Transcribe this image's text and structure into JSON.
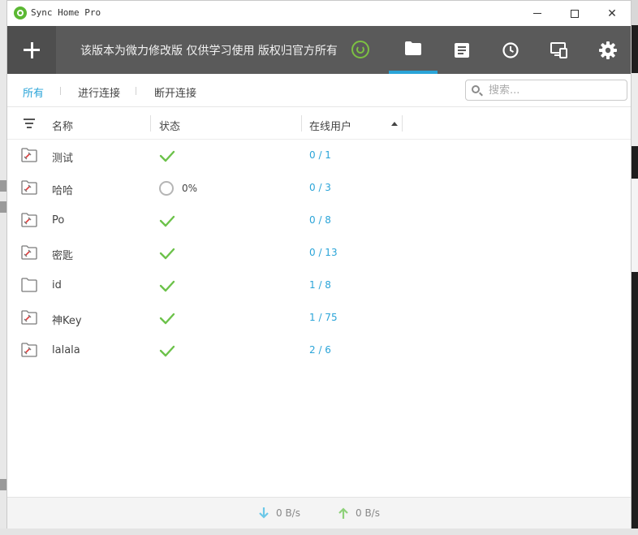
{
  "window": {
    "title": "Sync Home Pro",
    "controls": {
      "minimize": "minimize",
      "maximize": "maximize",
      "close": "✕"
    }
  },
  "toolbar": {
    "banner": "该版本为微力修改版 仅供学习使用 版权归官方所有",
    "tabs": [
      {
        "icon": "folder-icon",
        "active": true
      },
      {
        "icon": "document-icon",
        "active": false
      },
      {
        "icon": "clock-icon",
        "active": false
      },
      {
        "icon": "devices-icon",
        "active": false
      },
      {
        "icon": "gear-icon",
        "active": false
      }
    ]
  },
  "filters": {
    "tabs": [
      "所有",
      "进行连接",
      "断开连接"
    ],
    "active_index": 0,
    "search_placeholder": "搜索..."
  },
  "table": {
    "columns": [
      "名称",
      "状态",
      "在线用户"
    ],
    "sort_column": "在线用户",
    "sort_direction": "ascending",
    "rows": [
      {
        "name": "测试",
        "status": "ok",
        "status_text": "",
        "users": "0 / 1",
        "icon": "folder-broken"
      },
      {
        "name": "哈哈",
        "status": "progress",
        "status_text": "0%",
        "users": "0 / 3",
        "icon": "folder-broken"
      },
      {
        "name": "Po",
        "status": "ok",
        "status_text": "",
        "users": "0 / 8",
        "icon": "folder-broken"
      },
      {
        "name": "密匙",
        "status": "ok",
        "status_text": "",
        "users": "0 / 13",
        "icon": "folder-broken"
      },
      {
        "name": "id",
        "status": "ok",
        "status_text": "",
        "users": "1 / 8",
        "icon": "folder"
      },
      {
        "name": "神Key",
        "status": "ok",
        "status_text": "",
        "users": "1 / 75",
        "icon": "folder-broken"
      },
      {
        "name": "lalala",
        "status": "ok",
        "status_text": "",
        "users": "2 / 6",
        "icon": "folder-broken"
      }
    ]
  },
  "footer": {
    "download_rate": "0 B/s",
    "upload_rate": "0 B/s"
  },
  "colors": {
    "accent": "#2aa4d8",
    "toolbar": "#5a5a5a",
    "ok_green": "#6cc24a",
    "upload_green": "#8ed17a",
    "download_blue": "#6cc8e8",
    "error_red": "#e03c3c"
  }
}
